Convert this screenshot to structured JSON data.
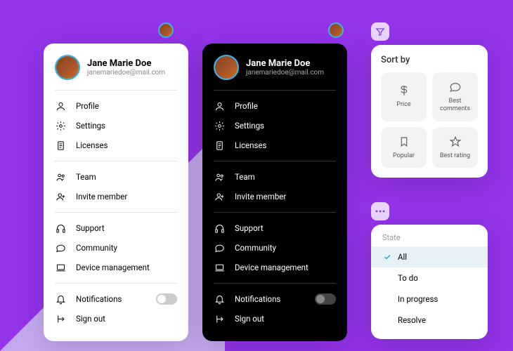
{
  "user": {
    "name": "Jane Marie Doe",
    "email": "janemariedoe@mail.com"
  },
  "menu_groups": [
    [
      {
        "key": "profile",
        "label": "Profile",
        "icon": "user"
      },
      {
        "key": "settings",
        "label": "Settings",
        "icon": "gear"
      },
      {
        "key": "licenses",
        "label": "Licenses",
        "icon": "document"
      }
    ],
    [
      {
        "key": "team",
        "label": "Team",
        "icon": "users"
      },
      {
        "key": "invite",
        "label": "Invite member",
        "icon": "user-plus"
      }
    ],
    [
      {
        "key": "support",
        "label": "Support",
        "icon": "headphones"
      },
      {
        "key": "community",
        "label": "Community",
        "icon": "chat"
      },
      {
        "key": "devices",
        "label": "Device management",
        "icon": "laptop"
      }
    ],
    [
      {
        "key": "notifications",
        "label": "Notifications",
        "icon": "bell",
        "toggle": true
      },
      {
        "key": "signout",
        "label": "Sign out",
        "icon": "logout"
      }
    ]
  ],
  "sort": {
    "title": "Sort by",
    "options": [
      {
        "key": "price",
        "label": "Price",
        "icon": "dollar"
      },
      {
        "key": "comments",
        "label": "Best comments",
        "icon": "chat"
      },
      {
        "key": "popular",
        "label": "Popular",
        "icon": "bookmark"
      },
      {
        "key": "rating",
        "label": "Best rating",
        "icon": "star"
      }
    ]
  },
  "state": {
    "title": "State",
    "options": [
      {
        "key": "all",
        "label": "All",
        "selected": true
      },
      {
        "key": "todo",
        "label": "To do",
        "selected": false
      },
      {
        "key": "inprogress",
        "label": "In progress",
        "selected": false
      },
      {
        "key": "resolve",
        "label": "Resolve",
        "selected": false
      }
    ]
  }
}
